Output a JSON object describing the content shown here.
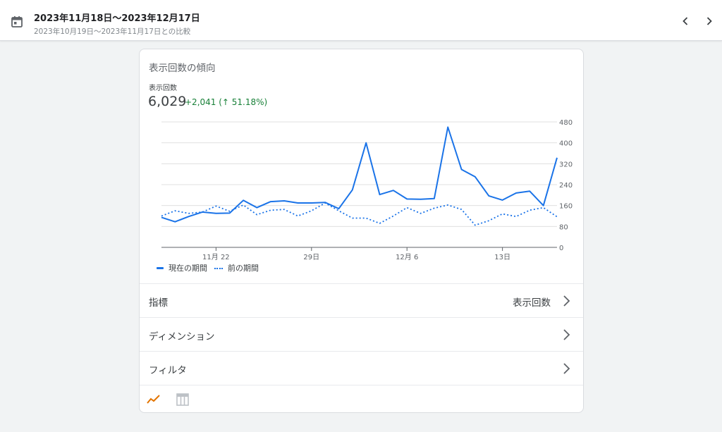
{
  "header": {
    "date_range": "2023年11月18日〜2023年12月17日",
    "comparison": "2023年10月19日〜2023年11月17日との比較"
  },
  "card": {
    "title": "表示回数の傾向",
    "metric_label": "表示回数",
    "metric_value": "6,029",
    "metric_delta": "+2,041 (↑ 51.18%)"
  },
  "chart_data": {
    "type": "line",
    "x": [
      "11月18日",
      "11月19日",
      "11月20日",
      "11月21日",
      "11月22日",
      "11月23日",
      "11月24日",
      "11月25日",
      "11月26日",
      "11月27日",
      "11月28日",
      "11月29日",
      "11月30日",
      "12月1日",
      "12月2日",
      "12月3日",
      "12月4日",
      "12月5日",
      "12月6日",
      "12月7日",
      "12月8日",
      "12月9日",
      "12月10日",
      "12月11日",
      "12月12日",
      "12月13日",
      "12月14日",
      "12月15日",
      "12月16日",
      "12月17日"
    ],
    "x_tick_labels": [
      {
        "index": 4,
        "label": "11月 22"
      },
      {
        "index": 11,
        "label": "29日"
      },
      {
        "index": 18,
        "label": "12月 6"
      },
      {
        "index": 25,
        "label": "13日"
      }
    ],
    "series": [
      {
        "name": "現在の期間",
        "style": "solid",
        "values": [
          115,
          98,
          118,
          135,
          130,
          131,
          180,
          152,
          175,
          178,
          170,
          170,
          172,
          148,
          220,
          400,
          202,
          218,
          185,
          184,
          187,
          460,
          298,
          270,
          197,
          181,
          208,
          215,
          160,
          343
        ]
      },
      {
        "name": "前の期間",
        "style": "dotted",
        "values": [
          120,
          140,
          130,
          135,
          158,
          138,
          162,
          125,
          142,
          145,
          120,
          140,
          170,
          140,
          112,
          112,
          92,
          120,
          152,
          130,
          150,
          162,
          145,
          85,
          102,
          128,
          118,
          142,
          152,
          117
        ]
      }
    ],
    "y_ticks": [
      0,
      80,
      160,
      240,
      320,
      400,
      480
    ],
    "ylim": [
      0,
      480
    ],
    "color": "#1a73e8",
    "grid": true,
    "legend_placement": "bottom-left"
  },
  "rows": [
    {
      "label": "指標",
      "value": "表示回数"
    },
    {
      "label": "ディメンション",
      "value": ""
    },
    {
      "label": "フィルタ",
      "value": ""
    }
  ],
  "icons": {
    "calendar": "calendar-icon",
    "prev": "chevron-left-icon",
    "next": "chevron-right-icon",
    "line_view": "line-chart-icon",
    "table_view": "table-icon"
  },
  "colors": {
    "accent": "#1a73e8",
    "positive": "#188038",
    "active_view": "#e37400"
  }
}
